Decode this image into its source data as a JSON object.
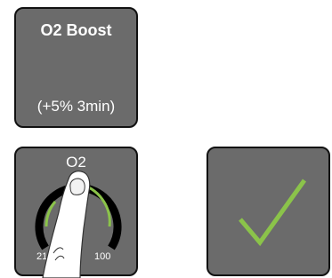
{
  "boost_tile": {
    "title": "O2 Boost",
    "subtitle": "(+5% 3min)"
  },
  "o2_tile": {
    "title": "O2",
    "min_label": "21",
    "max_label": "100",
    "dial_icon": "knob-dial-icon",
    "finger_icon": "finger-touch-icon"
  },
  "confirm_tile": {
    "icon": "checkmark-icon",
    "color": "#8bc34a"
  },
  "colors": {
    "tile_bg": "#6b6b6b",
    "tile_border": "#111111",
    "accent_green": "#8bc34a"
  }
}
